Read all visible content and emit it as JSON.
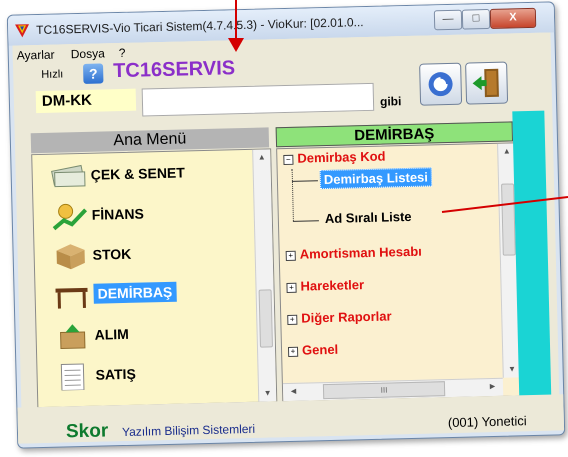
{
  "window": {
    "title": "TC16SERVIS-Vio Ticari Sistem(4.7.4.5.3) - VioKur: [02.01.0...",
    "buttons": {
      "minimize": "—",
      "maximize": "□",
      "close": "X"
    }
  },
  "menu": [
    "Ayarlar",
    "Dosya",
    "?"
  ],
  "header": {
    "speed_label": "Hızlı",
    "help_symbol": "?",
    "app_name": "TC16SERVIS",
    "code": "DM-KK",
    "search_value": "",
    "gibi_label": "gibi"
  },
  "left_panel": {
    "title": "Ana Menü",
    "items": [
      {
        "label": "ÇEK & SENET",
        "icon": "checks-icon"
      },
      {
        "label": "FİNANS",
        "icon": "finance-icon"
      },
      {
        "label": "STOK",
        "icon": "stock-box-icon"
      },
      {
        "label": "DEMİRBAŞ",
        "icon": "fixed-asset-icon",
        "selected": true
      },
      {
        "label": "ALIM",
        "icon": "purchase-icon"
      },
      {
        "label": "SATIŞ",
        "icon": "sales-icon"
      }
    ]
  },
  "right_panel": {
    "title": "DEMİRBAŞ",
    "tree": [
      {
        "label": "Demirbaş Kod",
        "expander": "−",
        "level": 0,
        "color": "red"
      },
      {
        "label": "Demirbaş Listesi",
        "level": 1,
        "selected": true
      },
      {
        "label": "Ad Sıralı Liste",
        "level": 1,
        "color": "black"
      },
      {
        "label": "Amortisman Hesabı",
        "expander": "+",
        "level": 0,
        "color": "red"
      },
      {
        "label": "Hareketler",
        "expander": "+",
        "level": 0,
        "color": "red"
      },
      {
        "label": "Diğer Raporlar",
        "expander": "+",
        "level": 0,
        "color": "red"
      },
      {
        "label": "Genel",
        "expander": "+",
        "level": 0,
        "color": "red"
      }
    ],
    "hscroll_glyph": "III"
  },
  "status": {
    "brand": "Skor",
    "company": "Yazılım Bilişim Sistemleri",
    "user": "(001) Yonetici"
  },
  "colors": {
    "app_name": "#8b2fc9",
    "left_header": "#b4b4b4",
    "right_header": "#8ee27a",
    "accent_strip": "#1ad4d4",
    "selection": "#3399ff",
    "annotation": "#d40000"
  }
}
